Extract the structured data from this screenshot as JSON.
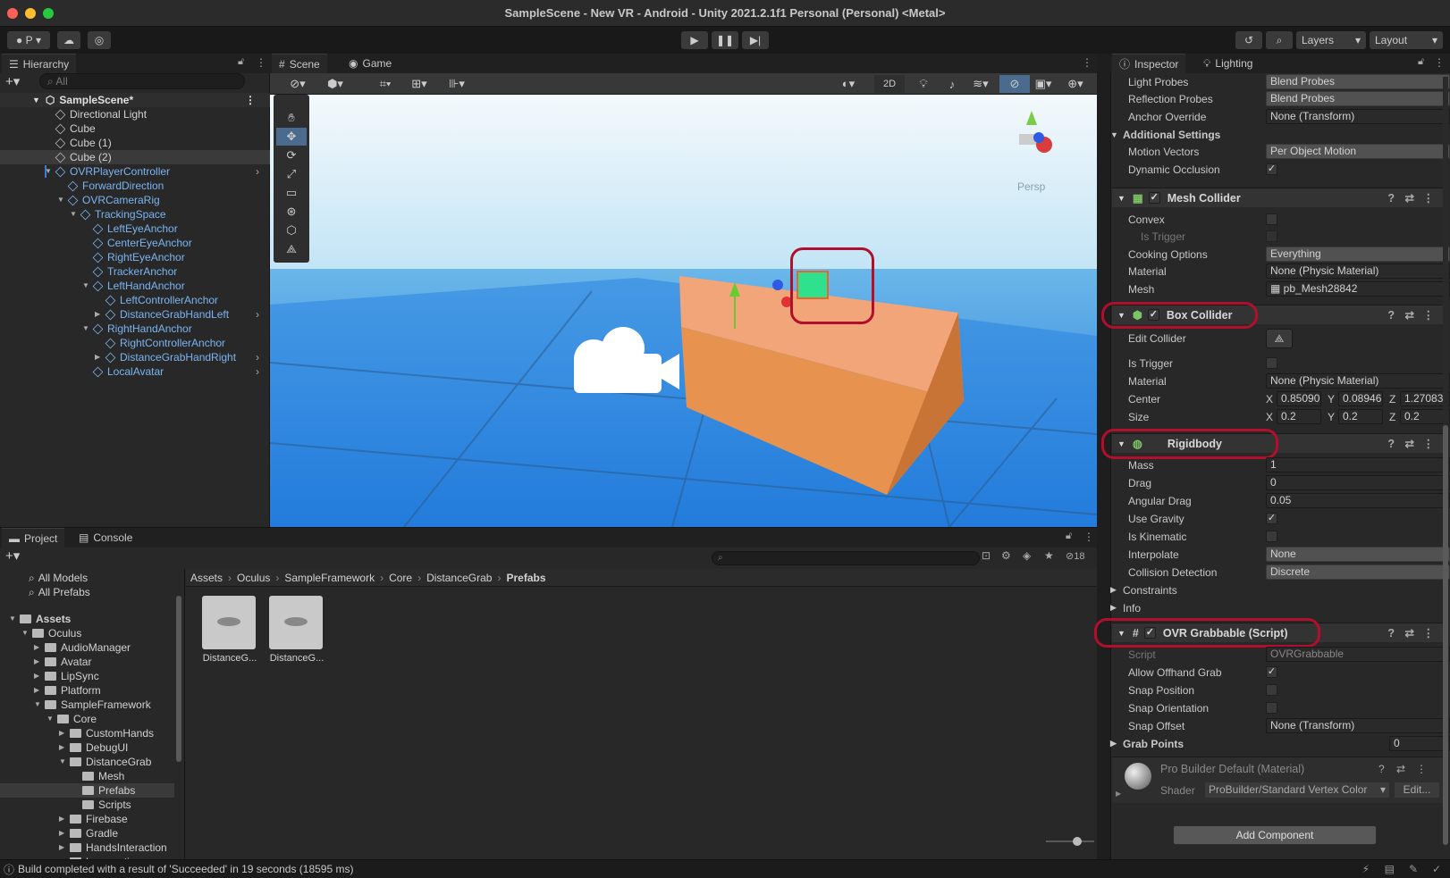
{
  "window": {
    "title": "SampleScene - New VR - Android - Unity 2021.2.1f1 Personal (Personal) <Metal>"
  },
  "toolbar": {
    "account": "P",
    "layers": "Layers",
    "layout": "Layout"
  },
  "hierarchy": {
    "tab": "Hierarchy",
    "search_placeholder": "All",
    "scene": "SampleScene*",
    "items": [
      {
        "label": "Directional Light",
        "indent": 0,
        "blue": false
      },
      {
        "label": "Cube",
        "indent": 0,
        "blue": false
      },
      {
        "label": "Cube (1)",
        "indent": 0,
        "blue": false
      },
      {
        "label": "Cube (2)",
        "indent": 0,
        "blue": false
      },
      {
        "label": "OVRPlayerController",
        "indent": 0,
        "blue": true
      },
      {
        "label": "ForwardDirection",
        "indent": 1,
        "blue": true
      },
      {
        "label": "OVRCameraRig",
        "indent": 1,
        "blue": true
      },
      {
        "label": "TrackingSpace",
        "indent": 2,
        "blue": true
      },
      {
        "label": "LeftEyeAnchor",
        "indent": 3,
        "blue": true
      },
      {
        "label": "CenterEyeAnchor",
        "indent": 3,
        "blue": true
      },
      {
        "label": "RightEyeAnchor",
        "indent": 3,
        "blue": true
      },
      {
        "label": "TrackerAnchor",
        "indent": 3,
        "blue": true
      },
      {
        "label": "LeftHandAnchor",
        "indent": 3,
        "blue": true
      },
      {
        "label": "LeftControllerAnchor",
        "indent": 4,
        "blue": true
      },
      {
        "label": "DistanceGrabHandLeft",
        "indent": 4,
        "blue": true
      },
      {
        "label": "RightHandAnchor",
        "indent": 3,
        "blue": true
      },
      {
        "label": "RightControllerAnchor",
        "indent": 4,
        "blue": true
      },
      {
        "label": "DistanceGrabHandRight",
        "indent": 4,
        "blue": true
      },
      {
        "label": "LocalAvatar",
        "indent": 3,
        "blue": true
      }
    ]
  },
  "scene": {
    "tab_scene": "Scene",
    "tab_game": "Game",
    "btn_2d": "2D",
    "persp": "Persp"
  },
  "project": {
    "tab_project": "Project",
    "tab_console": "Console",
    "count": "18",
    "favorites": [
      "All Models",
      "All Prefabs"
    ],
    "tree": [
      {
        "label": "Assets",
        "indent": 0,
        "bold": true
      },
      {
        "label": "Oculus",
        "indent": 1
      },
      {
        "label": "AudioManager",
        "indent": 2
      },
      {
        "label": "Avatar",
        "indent": 2
      },
      {
        "label": "LipSync",
        "indent": 2
      },
      {
        "label": "Platform",
        "indent": 2
      },
      {
        "label": "SampleFramework",
        "indent": 2
      },
      {
        "label": "Core",
        "indent": 3
      },
      {
        "label": "CustomHands",
        "indent": 4
      },
      {
        "label": "DebugUI",
        "indent": 4
      },
      {
        "label": "DistanceGrab",
        "indent": 4
      },
      {
        "label": "Mesh",
        "indent": 5
      },
      {
        "label": "Prefabs",
        "indent": 5
      },
      {
        "label": "Scripts",
        "indent": 5
      },
      {
        "label": "Firebase",
        "indent": 4
      },
      {
        "label": "Gradle",
        "indent": 4
      },
      {
        "label": "HandsInteraction",
        "indent": 4
      },
      {
        "label": "Locomotion",
        "indent": 4
      }
    ],
    "breadcrumb": [
      "Assets",
      "Oculus",
      "SampleFramework",
      "Core",
      "DistanceGrab",
      "Prefabs"
    ],
    "assets": [
      "DistanceG...",
      "DistanceG..."
    ]
  },
  "inspector": {
    "tab_inspector": "Inspector",
    "tab_lighting": "Lighting",
    "light_probes": {
      "label": "Light Probes",
      "value": "Blend Probes"
    },
    "reflection_probes": {
      "label": "Reflection Probes",
      "value": "Blend Probes"
    },
    "anchor_override": {
      "label": "Anchor Override",
      "value": "None (Transform)"
    },
    "additional_settings": "Additional Settings",
    "motion_vectors": {
      "label": "Motion Vectors",
      "value": "Per Object Motion"
    },
    "dynamic_occlusion": {
      "label": "Dynamic Occlusion",
      "checked": "✓"
    },
    "mesh_collider": {
      "title": "Mesh Collider",
      "convex": "Convex",
      "is_trigger": "Is Trigger",
      "cooking_label": "Cooking Options",
      "cooking_value": "Everything",
      "material_label": "Material",
      "material_value": "None (Physic Material)",
      "mesh_label": "Mesh",
      "mesh_value": "pb_Mesh28842"
    },
    "box_collider": {
      "title": "Box Collider",
      "edit": "Edit Collider",
      "is_trigger": "Is Trigger",
      "material_label": "Material",
      "material_value": "None (Physic Material)",
      "center_label": "Center",
      "cx": "0.85090",
      "cy": "0.08946",
      "cz": "1.27083",
      "size_label": "Size",
      "sx": "0.2",
      "sy": "0.2",
      "sz": "0.2"
    },
    "rigidbody": {
      "title": "Rigidbody",
      "mass_label": "Mass",
      "mass": "1",
      "drag_label": "Drag",
      "drag": "0",
      "ang_label": "Angular Drag",
      "ang": "0.05",
      "gravity": "Use Gravity",
      "gravity_check": "✓",
      "kinematic": "Is Kinematic",
      "interp_label": "Interpolate",
      "interp": "None",
      "coll_label": "Collision Detection",
      "coll": "Discrete",
      "constraints": "Constraints",
      "info": "Info"
    },
    "grabbable": {
      "title": "OVR Grabbable (Script)",
      "script_label": "Script",
      "script_value": "OVRGrabbable",
      "offhand": "Allow Offhand Grab",
      "offhand_check": "✓",
      "snap_pos": "Snap Position",
      "snap_orient": "Snap Orientation",
      "snap_offset_label": "Snap Offset",
      "snap_offset": "None (Transform)",
      "grab_points": "Grab Points",
      "grab_points_count": "0"
    },
    "material": {
      "name": "Pro Builder Default (Material)",
      "shader_label": "Shader",
      "shader": "ProBuilder/Standard Vertex Color",
      "edit": "Edit..."
    },
    "add_component": "Add Component"
  },
  "status": {
    "message": "Build completed with a result of 'Succeeded' in 19 seconds (18595 ms)"
  },
  "axis": {
    "x": "X",
    "y": "Y",
    "z": "Z"
  }
}
